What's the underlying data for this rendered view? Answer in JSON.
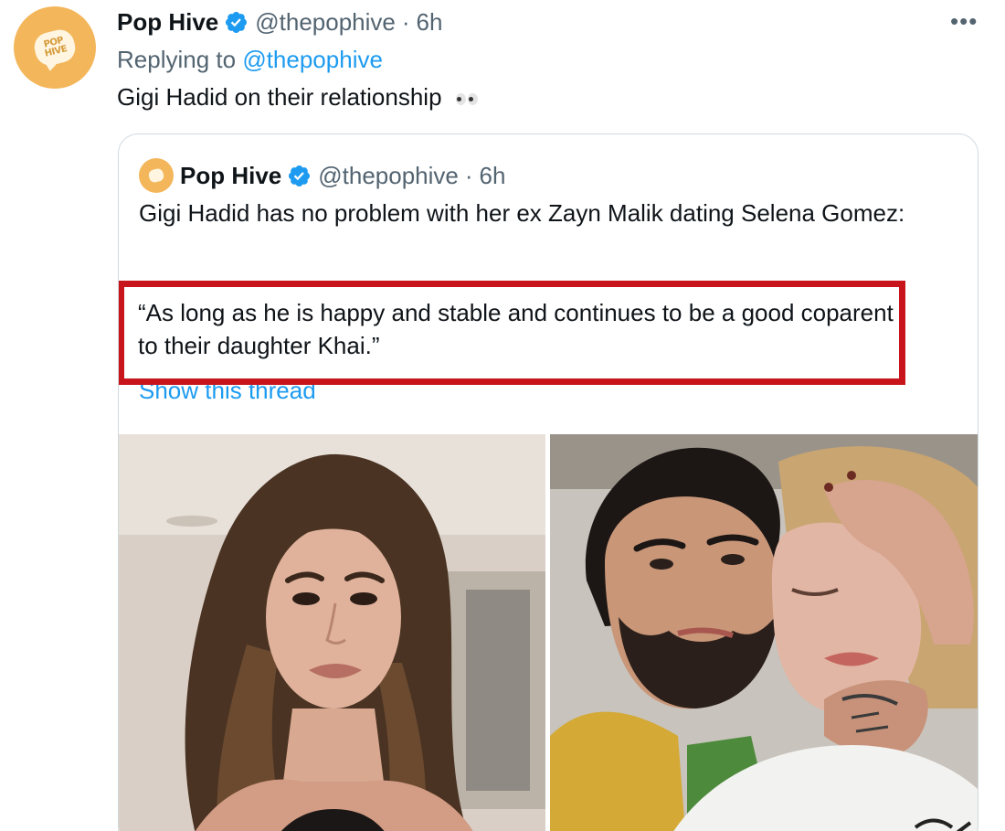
{
  "tweet": {
    "author_name": "Pop Hive",
    "author_handle": "@thepophive",
    "separator": "·",
    "time": "6h",
    "reply_prefix": "Replying to ",
    "reply_to": "@thepophive",
    "text": "Gigi Hadid on their relationship",
    "more_label": "•••"
  },
  "quoted": {
    "author_name": "Pop Hive",
    "author_handle": "@thepophive",
    "separator": "·",
    "time": "6h",
    "text": "Gigi Hadid has no problem with her ex Zayn Malik dating Selena Gomez:",
    "quote_text": "“As long as he is happy and stable and continues to be a good coparent to their daughter Khai.”",
    "show_thread": "Show this thread"
  },
  "colors": {
    "accent": "#1d9bf0",
    "secondary_text": "#536471",
    "highlight_border": "#c8141b",
    "avatar_bg": "#f3b65a"
  },
  "icons": {
    "verified": "verified-badge-icon",
    "more": "more-options-icon",
    "emoji": "eyes-emoji-icon"
  }
}
